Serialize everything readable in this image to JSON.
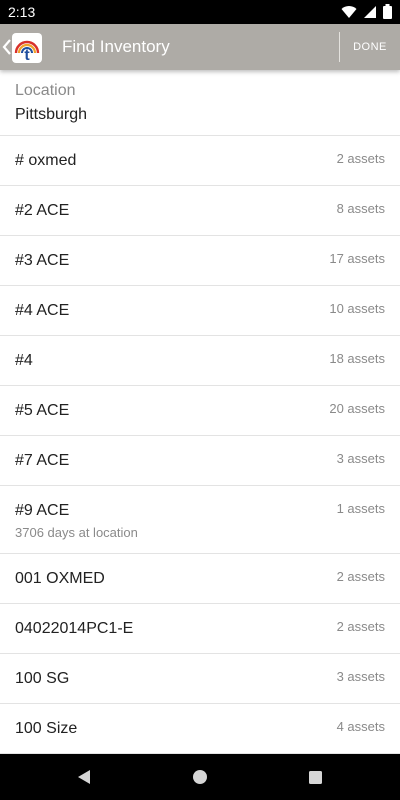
{
  "status_bar": {
    "time": "2:13"
  },
  "app_bar": {
    "title": "Find Inventory",
    "done_label": "DONE",
    "logo_letter": "t"
  },
  "location": {
    "label": "Location",
    "value": "Pittsburgh"
  },
  "items": [
    {
      "name": "# oxmed",
      "count": "2 assets"
    },
    {
      "name": "#2 ACE",
      "count": "8 assets"
    },
    {
      "name": "#3 ACE",
      "count": "17 assets"
    },
    {
      "name": "#4 ACE",
      "count": "10 assets"
    },
    {
      "name": "#4",
      "count": "18 assets"
    },
    {
      "name": "#5 ACE",
      "count": "20 assets"
    },
    {
      "name": "#7 ACE",
      "count": "3 assets"
    },
    {
      "name": "#9 ACE",
      "count": "1 assets",
      "sub": "3706 days at location"
    },
    {
      "name": "001 OXMED",
      "count": "2 assets"
    },
    {
      "name": "04022014PC1-E",
      "count": "2 assets"
    },
    {
      "name": "100 SG",
      "count": "3 assets"
    },
    {
      "name": "100 Size",
      "count": "4 assets"
    }
  ],
  "icons": {
    "wifi": "wifi-icon",
    "signal": "signal-icon",
    "battery": "battery-icon",
    "back": "back-triangle-icon",
    "home": "home-circle-icon",
    "recents": "recents-square-icon"
  },
  "colors": {
    "app_bar": "#aeaba6",
    "logo_blue": "#1f4e9e",
    "logo_red": "#d9302a",
    "logo_orange": "#f0a22a"
  }
}
